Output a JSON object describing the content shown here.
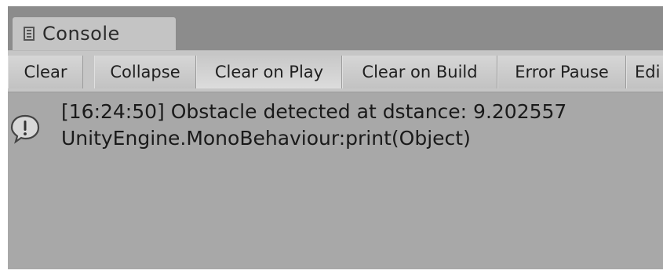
{
  "tab": {
    "title": "Console",
    "icon": "console-doc-icon"
  },
  "toolbar": {
    "buttons": [
      {
        "label": "Clear"
      },
      {
        "label": "Collapse"
      },
      {
        "label": "Clear on Play"
      },
      {
        "label": "Clear on Build"
      },
      {
        "label": "Error Pause"
      },
      {
        "label": "Edi"
      }
    ]
  },
  "log": {
    "entries": [
      {
        "icon": "info-speech-bubble-icon",
        "message": "[16:24:50] Obstacle detected at dstance: 9.202557",
        "stack": "UnityEngine.MonoBehaviour:print(Object)"
      }
    ]
  }
}
